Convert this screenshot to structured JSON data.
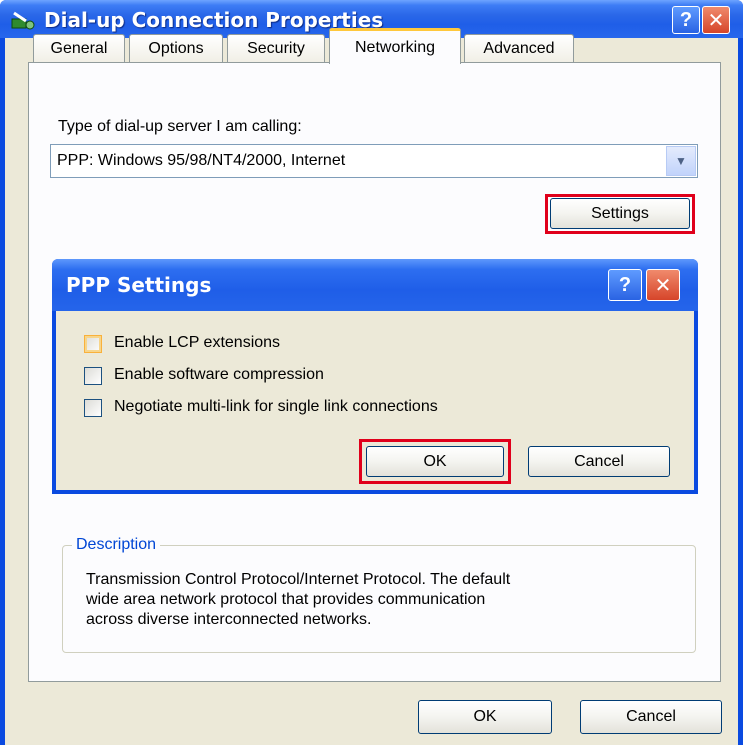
{
  "window": {
    "title": "Dial-up Connection Properties",
    "help_button": "?",
    "close_button": "✕"
  },
  "tabs": [
    {
      "label": "General",
      "active": false
    },
    {
      "label": "Options",
      "active": false
    },
    {
      "label": "Security",
      "active": false
    },
    {
      "label": "Networking",
      "active": true
    },
    {
      "label": "Advanced",
      "active": false
    }
  ],
  "networking": {
    "server_type_label": "Type of dial-up server I am calling:",
    "server_type_value": "PPP: Windows 95/98/NT4/2000, Internet",
    "settings_button": "Settings"
  },
  "ppp_dialog": {
    "title": "PPP Settings",
    "help_button": "?",
    "close_button": "✕",
    "options": [
      {
        "label": "Enable LCP extensions",
        "checked": false,
        "focused": true
      },
      {
        "label": "Enable software compression",
        "checked": false,
        "focused": false
      },
      {
        "label": "Negotiate multi-link for single link connections",
        "checked": false,
        "focused": false
      }
    ],
    "ok_button": "OK",
    "cancel_button": "Cancel"
  },
  "description": {
    "group_label": "Description",
    "lines": [
      "Transmission Control Protocol/Internet Protocol. The default",
      "wide area network protocol that provides communication",
      "across diverse interconnected networks."
    ]
  },
  "footer": {
    "ok_button": "OK",
    "cancel_button": "Cancel"
  },
  "colors": {
    "highlight": "#e0001b",
    "xp_blue": "#0a4ae0",
    "dialog_bg": "#ece9d8"
  }
}
